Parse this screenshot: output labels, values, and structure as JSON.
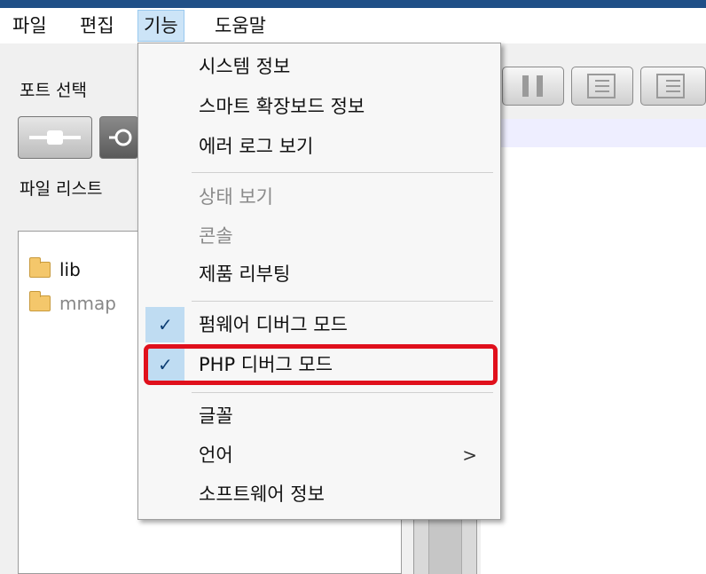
{
  "menubar": {
    "items": [
      {
        "label": "파일"
      },
      {
        "label": "편집"
      },
      {
        "label": "기능"
      },
      {
        "label": "도움말"
      }
    ]
  },
  "left_panel": {
    "port_select_label": "포트 선택",
    "file_list_label": "파일 리스트",
    "files": [
      {
        "name": "lib"
      },
      {
        "name": "mmap"
      }
    ]
  },
  "dropdown": {
    "group1": [
      {
        "label": "시스템 정보"
      },
      {
        "label": "스마트 확장보드 정보"
      },
      {
        "label": "에러 로그 보기"
      }
    ],
    "group2": [
      {
        "label": "상태 보기",
        "enabled": false
      },
      {
        "label": "콘솔",
        "enabled": false
      },
      {
        "label": "제품 리부팅",
        "enabled": true
      }
    ],
    "group3": [
      {
        "label": "펌웨어 디버그 모드",
        "checked": true
      },
      {
        "label": "PHP 디버그 모드",
        "checked": true
      }
    ],
    "group4": [
      {
        "label": "글꼴"
      },
      {
        "label": "언어",
        "submenu_arrow": ">"
      },
      {
        "label": "소프트웨어 정보"
      }
    ],
    "check_glyph": "✓"
  },
  "colors": {
    "accent_bar": "#1f4f87",
    "active_menu_bg": "#cce4f7",
    "highlight_border": "#e0101c",
    "check_bg": "#bfdcf2"
  }
}
